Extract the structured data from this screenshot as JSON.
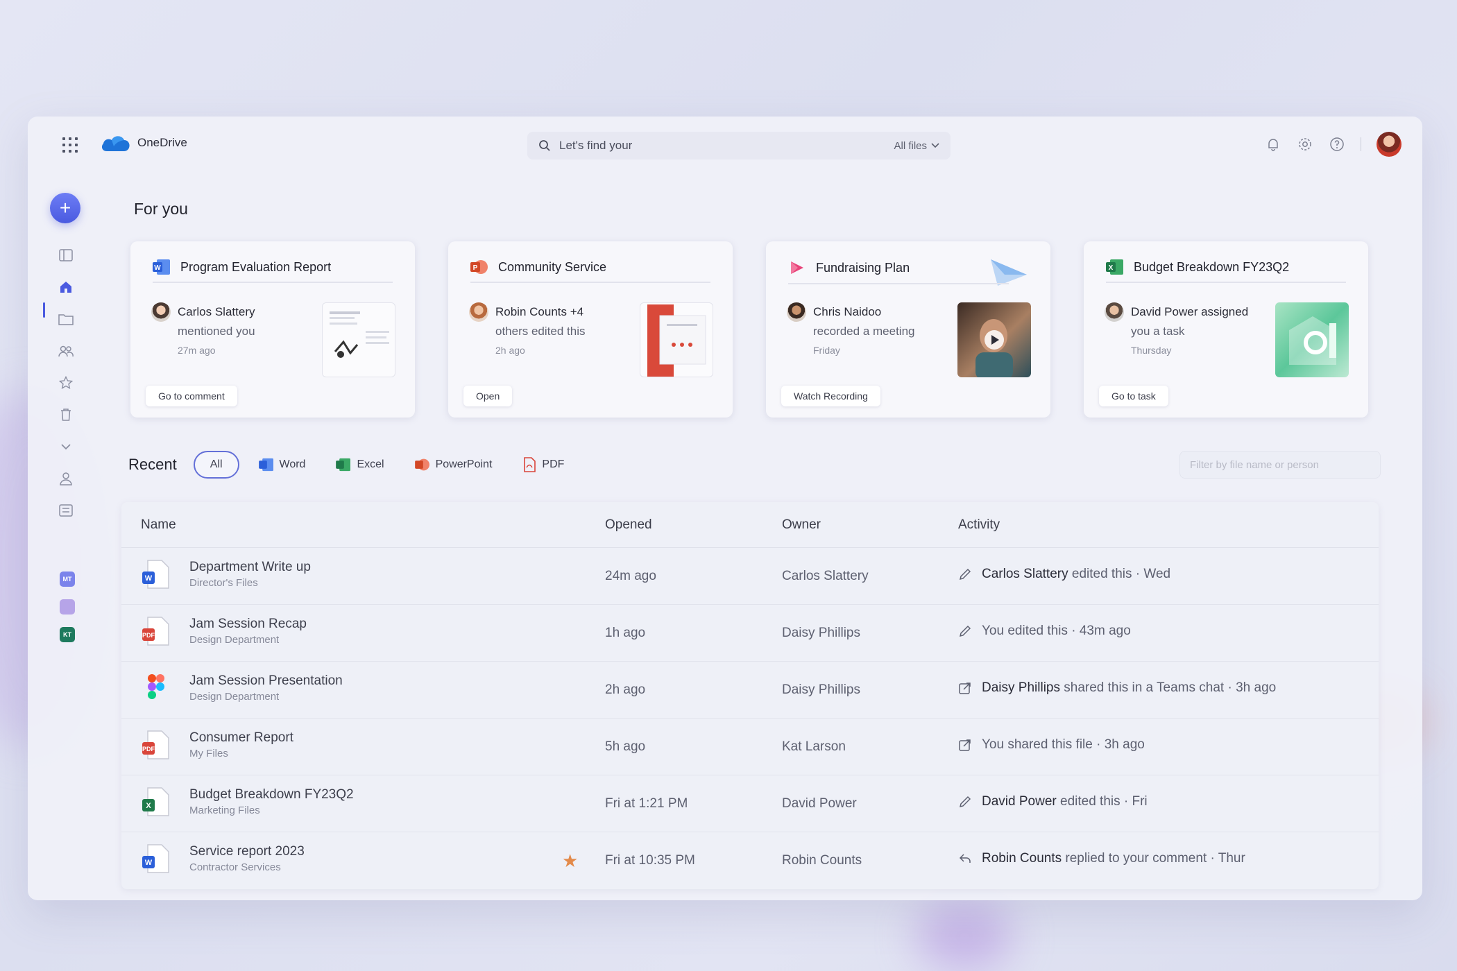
{
  "app": {
    "name": "OneDrive"
  },
  "search": {
    "placeholder": "Let's find your",
    "scope": "All files"
  },
  "left_rail": {
    "new_label": "+",
    "apps": [
      {
        "abbr": "MT",
        "color": "#7b83eb"
      },
      {
        "abbr": "",
        "color": "#b6a4e8"
      },
      {
        "abbr": "KT",
        "color": "#1e7a5e"
      }
    ]
  },
  "for_you": {
    "title": "For you",
    "cards": [
      {
        "title": "Program Evaluation Report",
        "app_icon": "word-icon",
        "person": "Carlos Slattery",
        "action": "mentioned you",
        "when": "27m ago",
        "button": "Go to comment"
      },
      {
        "title": "Community Service",
        "app_icon": "powerpoint-icon",
        "person": "Robin Counts +4",
        "action": "others edited this",
        "when": "2h ago",
        "button": "Open"
      },
      {
        "title": "Fundraising Plan",
        "app_icon": "stream-icon",
        "person": "Chris Naidoo",
        "action": "recorded a meeting",
        "when": "Friday",
        "button": "Watch Recording"
      },
      {
        "title": "Budget Breakdown FY23Q2",
        "app_icon": "excel-icon",
        "person": "David Power assigned",
        "action": "you a task",
        "when": "Thursday",
        "button": "Go to task"
      }
    ]
  },
  "recent": {
    "title": "Recent",
    "filters": [
      "All",
      "Word",
      "Excel",
      "PowerPoint",
      "PDF"
    ],
    "filter_placeholder": "Filter by file name or person",
    "columns": {
      "name": "Name",
      "opened": "Opened",
      "owner": "Owner",
      "activity": "Activity"
    },
    "rows": [
      {
        "name": "Department Write up",
        "location": "Director's Files",
        "type": "word",
        "opened": "24m ago",
        "owner": "Carlos Slattery",
        "activity_icon": "pencil-icon",
        "activity_who": "Carlos Slattery",
        "activity_text": " edited this · Wed",
        "starred": false
      },
      {
        "name": "Jam Session Recap",
        "location": "Design Department",
        "type": "pdf",
        "opened": "1h ago",
        "owner": "Daisy Phillips",
        "activity_icon": "pencil-icon",
        "activity_who": "",
        "activity_text": "You edited this · 43m ago",
        "starred": false
      },
      {
        "name": "Jam Session Presentation",
        "location": "Design Department",
        "type": "figma",
        "opened": "2h ago",
        "owner": "Daisy Phillips",
        "activity_icon": "share-icon",
        "activity_who": "Daisy Phillips",
        "activity_text": " shared this in a Teams chat · 3h ago",
        "starred": false
      },
      {
        "name": "Consumer Report",
        "location": "My Files",
        "type": "pdf",
        "opened": "5h ago",
        "owner": "Kat Larson",
        "activity_icon": "share-icon",
        "activity_who": "",
        "activity_text": "You shared this file · 3h ago",
        "starred": false
      },
      {
        "name": "Budget Breakdown FY23Q2",
        "location": "Marketing Files",
        "type": "excel",
        "opened": "Fri at 1:21 PM",
        "owner": "David Power",
        "activity_icon": "pencil-icon",
        "activity_who": "David Power",
        "activity_text": " edited this · Fri",
        "starred": false
      },
      {
        "name": "Service report 2023",
        "location": "Contractor Services",
        "type": "word",
        "opened": "Fri at 10:35 PM",
        "owner": "Robin Counts",
        "activity_icon": "reply-icon",
        "activity_who": "Robin Counts",
        "activity_text": " replied to your comment · Thur",
        "starred": true
      }
    ]
  },
  "colors": {
    "accent": "#4a5ae0",
    "word": "#2b5fd9",
    "excel": "#1f7a4a",
    "powerpoint": "#d24726",
    "pdf": "#d9453a"
  }
}
